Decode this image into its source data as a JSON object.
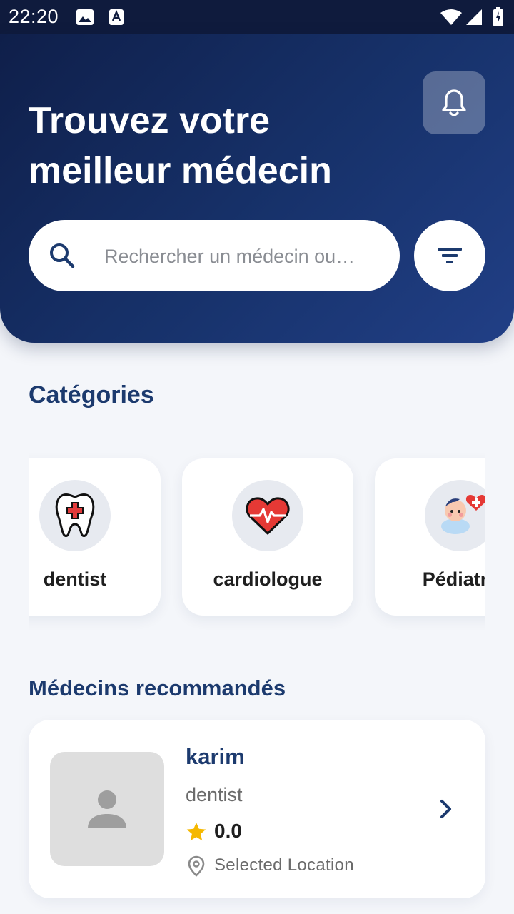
{
  "status_bar": {
    "time": "22:20",
    "icons": [
      "image-icon",
      "a-icon",
      "wifi-icon",
      "signal-icon",
      "battery-icon"
    ]
  },
  "header": {
    "title_line1": "Trouvez votre",
    "title_line2": "meilleur médecin",
    "bell_icon": "bell-icon",
    "filter_icon": "filter-icon"
  },
  "search": {
    "placeholder": "Rechercher un médecin ou…",
    "value": "",
    "icon": "search-icon"
  },
  "categories": {
    "title": "Catégories",
    "items": [
      {
        "label": "dentist",
        "icon": "tooth-icon"
      },
      {
        "label": "cardiologue",
        "icon": "heart-icon"
      },
      {
        "label": "Pédiatre",
        "icon": "baby-icon"
      }
    ]
  },
  "recommended": {
    "title": "Médecins recommandés",
    "doctors": [
      {
        "name": "karim",
        "specialty": "dentist",
        "rating": "0.0",
        "location": "Selected Location"
      }
    ]
  },
  "colors": {
    "header_dark": "#0f1f4a",
    "header_light": "#213f86",
    "accent": "#1c3a6e",
    "star": "#f5b800",
    "background": "#f4f6fa"
  }
}
